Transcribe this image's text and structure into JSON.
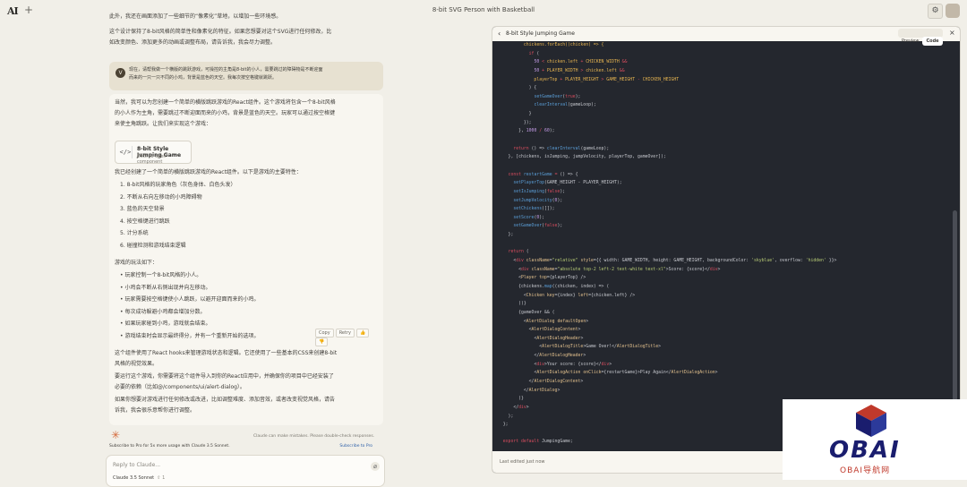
{
  "topbar": {
    "logo": "AI",
    "new_chat": "+",
    "title": "8-bit SVG Person with Basketball",
    "settings_icon": "sliders-icon"
  },
  "chat": {
    "prev_line1": "此外，我还在画面添加了一些细节的“像素化”草地，以增加一些环境感。",
    "prev_line2": "这个设计保持了8-bit风格的简单性和像素化的特征。如果您想要对这个SVG进行任何修改，比",
    "prev_line3": "如改变颜色、添加更多的动画或调整布局，请告诉我，我会尽力调整。",
    "user_avatar": "V",
    "user_line1": "现在，请帮我做一个横版的跳跃游戏，可操控的主角是8-bit的小人，需要跳过的障碍物是不断迎面",
    "user_line2": "而来的一只一只不同的小鸡，背景是蓝色的天空。我每次按空格键就跳跃。",
    "resp_intro1": "当然，我可以为您创建一个简单的横版跳跃游戏的React组件。这个游戏将包含一个8-bit风格",
    "resp_intro2": "的小人作为主角，需要跳过不断迎面而来的小鸡，背景是蓝色的天空。玩家可以通过按空格键",
    "resp_intro3": "来使主角跳跃。让我们来实现这个游戏：",
    "artifact_title": "8-bit Style Jumping Game",
    "artifact_sub": "Click to open component",
    "artifact_icon": "</>",
    "features_intro": "我已经创建了一个简单的横版跳跃游戏的React组件。以下是游戏的主要特性：",
    "features": [
      "1. 8-bit风格的玩家角色（灰色身体、白色头发）",
      "2. 不断从右向左移动的小鸡障碍物",
      "3. 蓝色的天空背景",
      "4. 按空格键进行跳跃",
      "5. 计分系统",
      "6. 碰撞检测和游戏结束逻辑"
    ],
    "rules_intro": "游戏的玩法如下：",
    "rules": [
      "• 玩家控制一个8-bit风格的小人。",
      "• 小鸡会不断从右侧出现并向左移动。",
      "• 玩家需要按空格键使小人跳跃，以避开迎面而来的小鸡。",
      "• 每次成功躲避小鸡都会增加分数。",
      "• 如果玩家碰到小鸡，游戏就会结束。",
      "• 游戏结束时会显示最终得分，并有一个重新开始的选项。"
    ],
    "outro1": "这个组件使用了React hooks来管理游戏状态和逻辑。它还使用了一些基本的CSS来创建8-bit",
    "outro2": "风格的视觉效果。",
    "outro3": "要运行这个游戏，你需要将这个组件导入到你的React应用中，并确保你的项目中已经安装了",
    "outro4": "必要的依赖（比如@/components/ui/alert-dialog）。",
    "outro5": "如果你想要对游戏进行任何修改或改进，比如调整难度、添加音效，或者改变视觉风格，请告",
    "outro6": "诉我，我会很乐意帮你进行调整。",
    "copy_label": "Copy",
    "retry_label": "Retry",
    "disclaimer": "Claude can make mistakes. Please double-check responses.",
    "pro_text": "Subscribe to Pro for 5x more usage with Claude 3.5 Sonnet.",
    "pro_link": "Subscribe to Pro",
    "input_placeholder": "Reply to Claude...",
    "model": "Claude 3.5 Sonnet",
    "model_count": "1"
  },
  "artifact_panel": {
    "title": "8-bit Style Jumping Game",
    "tab_preview": "Preview",
    "tab_code": "Code",
    "footer": "Last edited just now"
  },
  "watermark": {
    "brand": "OBAI",
    "sub": "OBAI导航网"
  }
}
